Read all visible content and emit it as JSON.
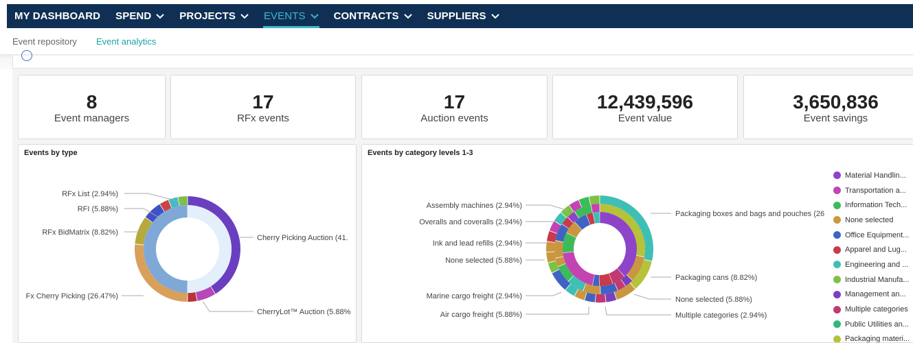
{
  "topnav": {
    "items": [
      {
        "label": "MY DASHBOARD",
        "chevron": false,
        "active": false
      },
      {
        "label": "SPEND",
        "chevron": true,
        "active": false
      },
      {
        "label": "PROJECTS",
        "chevron": true,
        "active": false
      },
      {
        "label": "EVENTS",
        "chevron": true,
        "active": true
      },
      {
        "label": "CONTRACTS",
        "chevron": true,
        "active": false
      },
      {
        "label": "SUPPLIERS",
        "chevron": true,
        "active": false
      }
    ]
  },
  "subnav": {
    "items": [
      {
        "label": "Event repository",
        "active": false
      },
      {
        "label": "Event analytics",
        "active": true
      }
    ]
  },
  "stats": [
    {
      "value": "8",
      "label": "Event managers"
    },
    {
      "value": "17",
      "label": "RFx events"
    },
    {
      "value": "17",
      "label": "Auction events"
    },
    {
      "value": "12,439,596",
      "label": "Event value"
    },
    {
      "value": "3,650,836",
      "label": "Event savings"
    }
  ],
  "events_by_type": {
    "title": "Events by type",
    "labels": [
      "RFx List (2.94%)",
      "RFI (5.88%)",
      "RFx BidMatrix (8.82%)",
      "Fx Cherry Picking (26.47%)",
      "Cherry Picking Auction (41.",
      "CherryLot™ Auction (5.88%"
    ]
  },
  "events_by_category": {
    "title": "Events by category levels 1-3",
    "labels": [
      "Assembly machines (2.94%)",
      "Overalls and coveralls (2.94%)",
      "Ink and lead refills (2.94%)",
      "None selected (5.88%)",
      "Marine cargo freight (2.94%)",
      "Air cargo freight (5.88%)",
      "Packaging boxes and bags and pouches (26",
      "Packaging cans (8.82%)",
      "None selected (5.88%)",
      "Multiple categories (2.94%)"
    ],
    "legend": [
      {
        "label": "Material Handlin...",
        "color": "#8e44c8"
      },
      {
        "label": "Transportation a...",
        "color": "#c244b2"
      },
      {
        "label": "Information Tech...",
        "color": "#3dbb5a"
      },
      {
        "label": "None selected",
        "color": "#c9973f"
      },
      {
        "label": "Office Equipment...",
        "color": "#3f63c4"
      },
      {
        "label": "Apparel and Lug...",
        "color": "#c93a4a"
      },
      {
        "label": "Engineering and ...",
        "color": "#3ebfb5"
      },
      {
        "label": "Industrial Manufa...",
        "color": "#7cc243"
      },
      {
        "label": "Management an...",
        "color": "#7a3fc0"
      },
      {
        "label": "Multiple categories",
        "color": "#c03a72"
      },
      {
        "label": "Public Utilities an...",
        "color": "#2fb879"
      },
      {
        "label": "Packaging materi...",
        "color": "#b5c23a"
      }
    ]
  },
  "colors": {
    "nav_bg": "#0f3054",
    "accent": "#3cb8c9"
  }
}
